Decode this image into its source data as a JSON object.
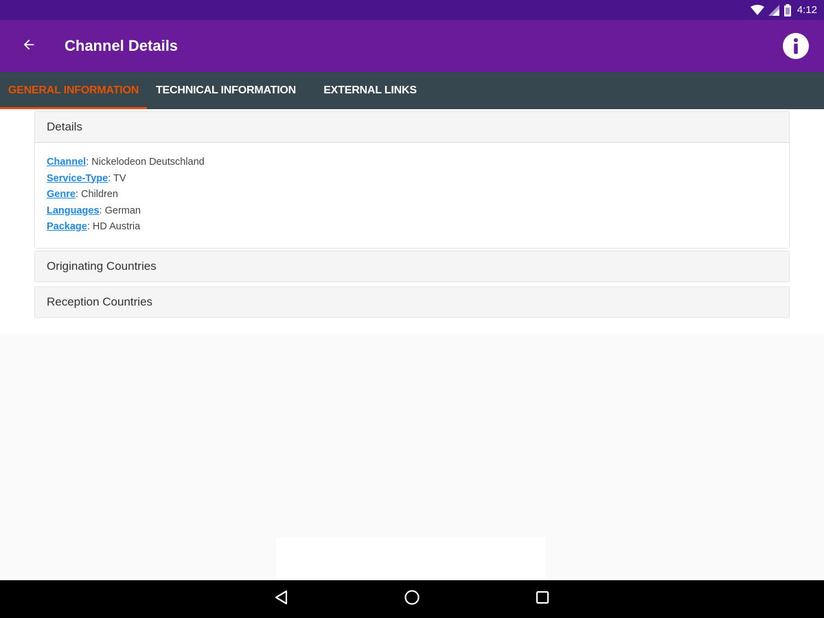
{
  "status_bar": {
    "time": "4:12",
    "icons": [
      "wifi-icon",
      "cell-signal-icon",
      "battery-icon"
    ]
  },
  "app_bar": {
    "title": "Channel Details",
    "back_icon": "arrow-left-icon",
    "info_icon": "info-icon"
  },
  "tabs": [
    {
      "label": "GENERAL INFORMATION",
      "active": true
    },
    {
      "label": "TECHNICAL INFORMATION",
      "active": false
    },
    {
      "label": "EXTERNAL LINKS",
      "active": false
    }
  ],
  "details": {
    "heading": "Details",
    "rows": [
      {
        "label": "Channel",
        "value": ": Nickelodeon Deutschland"
      },
      {
        "label": "Service-Type",
        "value": ": TV"
      },
      {
        "label": "Genre",
        "value": ": Children"
      },
      {
        "label": "Languages",
        "value": ": German"
      },
      {
        "label": "Package",
        "value": ": HD Austria"
      }
    ]
  },
  "originating": {
    "heading": "Originating Countries"
  },
  "reception": {
    "heading": "Reception Countries"
  },
  "nav_bar": {
    "icons": [
      "nav-back-icon",
      "nav-home-icon",
      "nav-recents-icon"
    ]
  },
  "colors": {
    "status_bar": "#4a148c",
    "app_bar": "#6a1b9a",
    "tab_bar": "#37474f",
    "tab_active": "#e65100",
    "link": "#1e88e5"
  }
}
